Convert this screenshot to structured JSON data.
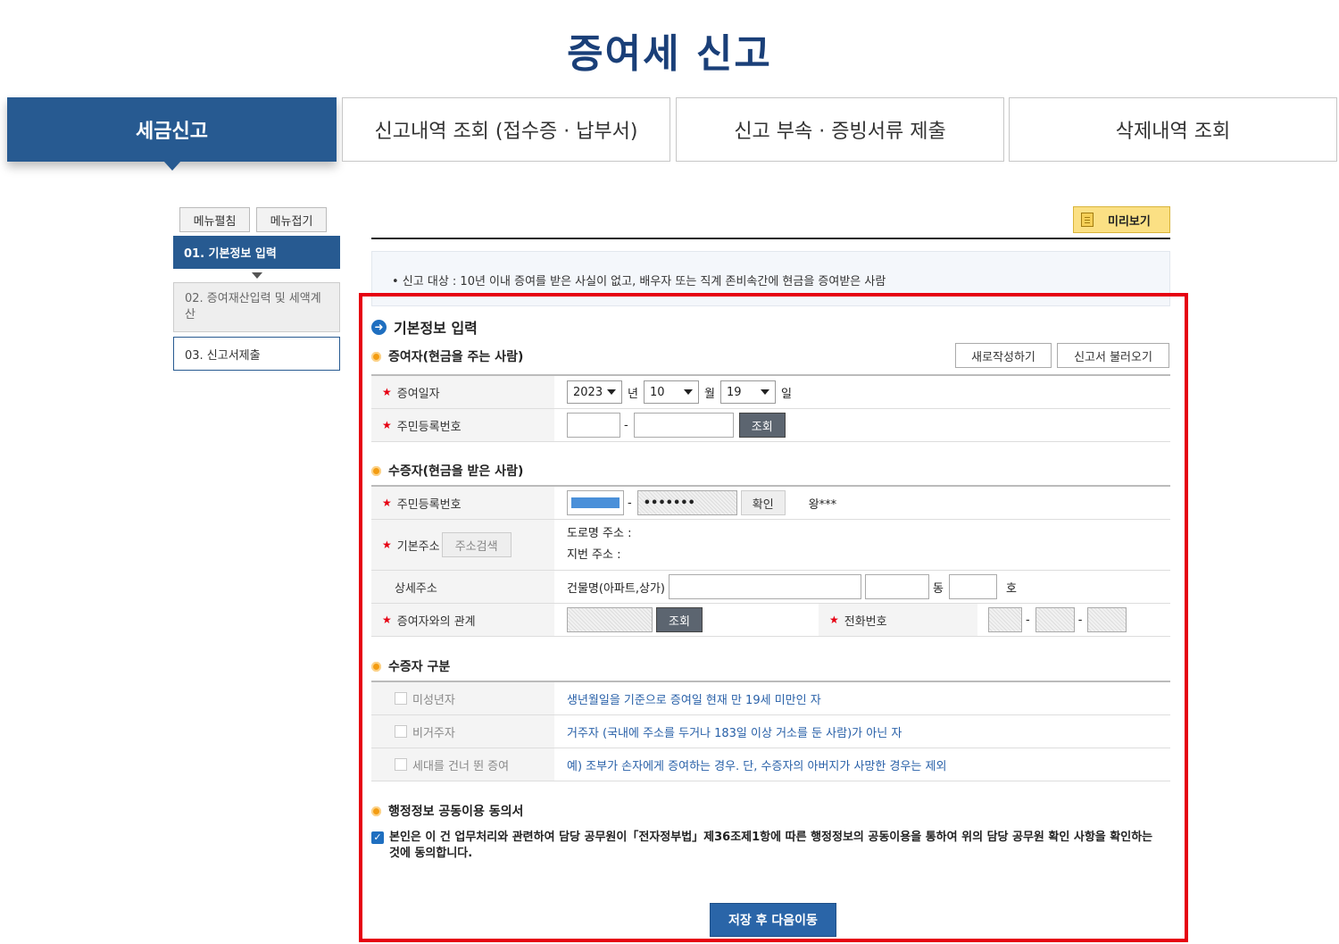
{
  "page": {
    "title": "증여세 신고"
  },
  "tabs": [
    {
      "label": "세금신고",
      "active": true
    },
    {
      "label": "신고내역 조회 (접수증 · 납부서)"
    },
    {
      "label": "신고 부속 · 증빙서류 제출"
    },
    {
      "label": "삭제내역 조회"
    }
  ],
  "sidebar": {
    "expand_label": "메뉴펼침",
    "collapse_label": "메뉴접기",
    "steps": [
      {
        "label": "01. 기본정보 입력"
      },
      {
        "label": "02. 증여재산입력 및 세액계산"
      },
      {
        "label": "03. 신고서제출"
      }
    ]
  },
  "toolbar": {
    "preview_label": "미리보기"
  },
  "notice": {
    "text": "• 신고 대상 : 10년 이내 증여를 받은 사실이 없고, 배우자 또는 직계 존비속간에 현금을 증여받은 사람"
  },
  "form": {
    "title": "기본정보 입력",
    "donor": {
      "section_title": "증여자(현금을 주는 사람)",
      "new_button": "새로작성하기",
      "load_button": "신고서 불러오기",
      "date_label": "증여일자",
      "year": "2023",
      "year_unit": "년",
      "month": "10",
      "month_unit": "월",
      "day": "19",
      "day_unit": "일",
      "rrn_label": "주민등록번호",
      "rrn_sep": "-",
      "lookup_button": "조회"
    },
    "donee": {
      "section_title": "수증자(현금을 받은 사람)",
      "rrn_label": "주민등록번호",
      "rrn_sep": "-",
      "rrn_masked": "•••••••",
      "confirm_button": "확인",
      "name_masked": "왕***",
      "address_label": "기본주소",
      "address_search_button": "주소검색",
      "road_address_label": "도로명 주소 :",
      "lot_address_label": "지번 주소 :",
      "detail_label": "상세주소",
      "building_label": "건물명(아파트,상가)",
      "dong_unit": "동",
      "ho_unit": "호",
      "relation_label": "증여자와의 관계",
      "relation_lookup_button": "조회",
      "phone_label": "전화번호",
      "phone_sep": "-"
    },
    "donee_type": {
      "section_title": "수증자 구분",
      "items": [
        {
          "label": "미성년자",
          "desc": "생년월일을 기준으로 증여일 현재 만 19세 미만인 자"
        },
        {
          "label": "비거주자",
          "desc": "거주자 (국내에 주소를 두거나 183일 이상 거소를 둔 사람)가 아닌 자"
        },
        {
          "label": "세대를 건너 뛴 증여",
          "desc": "예) 조부가 손자에게 증여하는 경우. 단, 수증자의 아버지가 사망한 경우는 제외"
        }
      ]
    },
    "consent": {
      "section_title": "행정정보 공동이용 동의서",
      "text": "본인은 이 건 업무처리와 관련하여 담당 공무원이「전자정부법」제36조제1항에 따른 행정정보의 공동이용을 통하여 위의 담당 공무원 확인 사항을 확인하는 것에 동의합니다.",
      "checked": true
    },
    "save_button": "저장 후 다음이동"
  },
  "colors": {
    "primary": "#275a91",
    "highlight_frame": "#e60012",
    "preview_bg": "#fbe084"
  }
}
